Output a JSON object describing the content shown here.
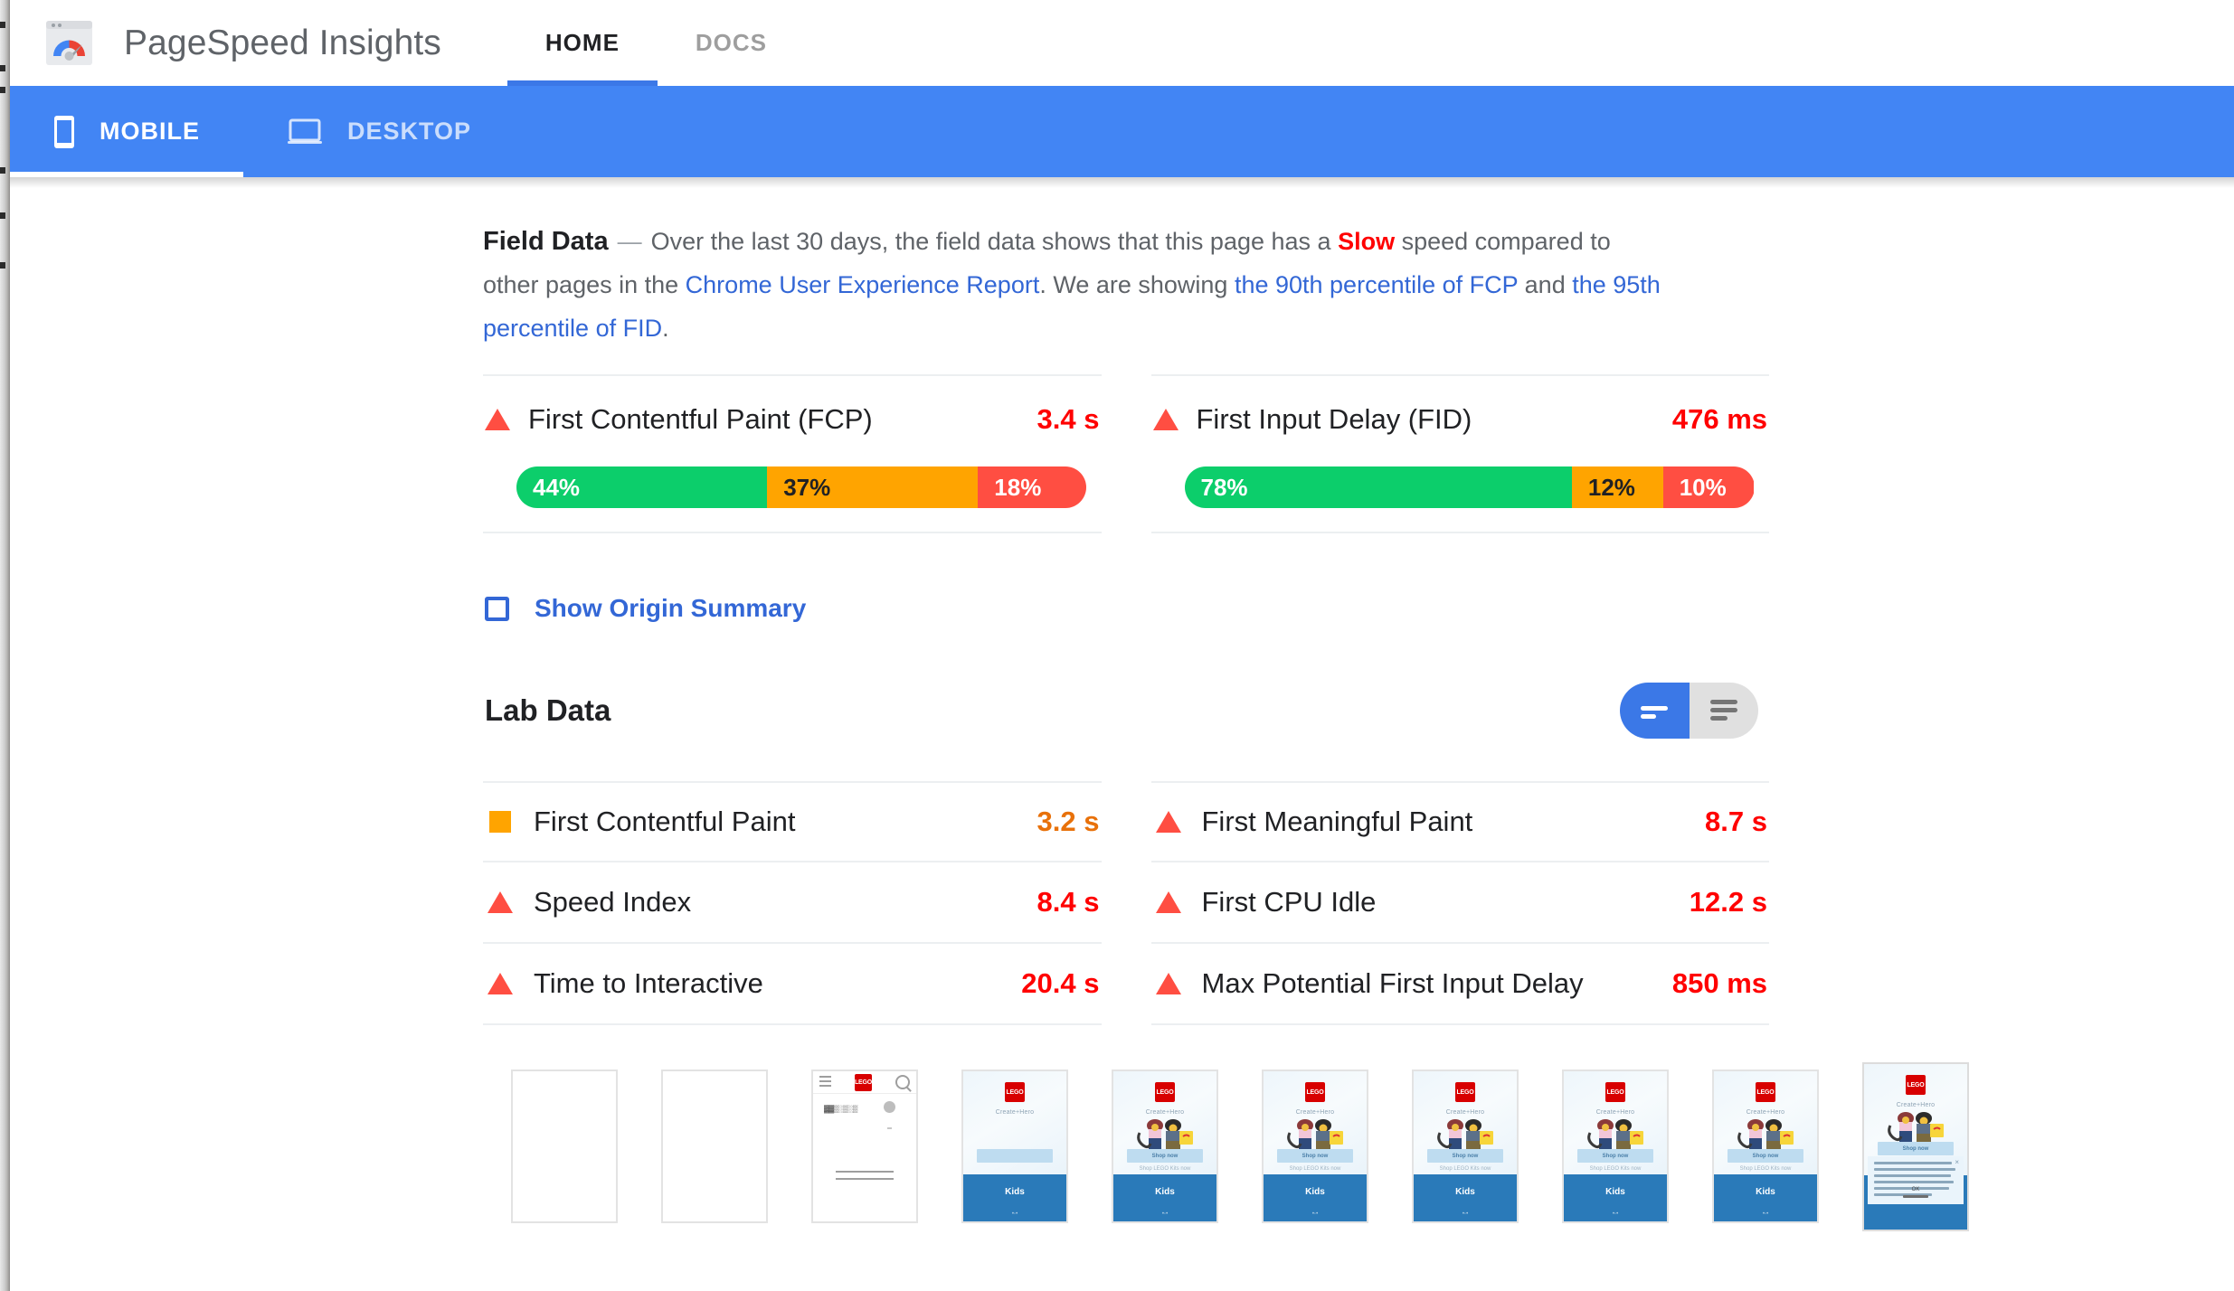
{
  "app": {
    "brand_title": "PageSpeed Insights",
    "logo_icon": "pagespeed-gauge-logo",
    "top_tabs": [
      {
        "label": "HOME",
        "active": true
      },
      {
        "label": "DOCS",
        "active": false
      }
    ],
    "device_tabs": [
      {
        "label": "MOBILE",
        "icon": "mobile-phone-icon",
        "active": true
      },
      {
        "label": "DESKTOP",
        "icon": "laptop-icon",
        "active": false
      }
    ]
  },
  "field_data": {
    "title": "Field Data",
    "dash": "—",
    "text_1": "Over the last 30 days, the field data shows that this page has a ",
    "verdict": "Slow",
    "text_2": " speed compared to other pages in the ",
    "link_crux": "Chrome User Experience Report",
    "text_3": ". We are showing ",
    "link_fcp": "the 90th percentile of FCP",
    "text_4": " and ",
    "link_fid": "the 95th percentile of FID",
    "text_5": ".",
    "metrics": [
      {
        "name": "First Contentful Paint (FCP)",
        "value": "3.4 s",
        "icon": "warning-triangle-icon",
        "status_color": "#ff4e42",
        "distribution": [
          {
            "label": "44%",
            "pct": 44,
            "bucket": "good",
            "color": "#0cce6b"
          },
          {
            "label": "37%",
            "pct": 37,
            "bucket": "average",
            "color": "#ffa400"
          },
          {
            "label": "18%",
            "pct": 19,
            "bucket": "slow",
            "color": "#ff4e42"
          }
        ]
      },
      {
        "name": "First Input Delay (FID)",
        "value": "476 ms",
        "icon": "warning-triangle-icon",
        "status_color": "#ff4e42",
        "distribution": [
          {
            "label": "78%",
            "pct": 68,
            "bucket": "good",
            "color": "#0cce6b"
          },
          {
            "label": "12%",
            "pct": 16,
            "bucket": "average",
            "color": "#ffa400"
          },
          {
            "label": "10%",
            "pct": 16,
            "bucket": "slow",
            "color": "#ff4e42"
          }
        ]
      }
    ],
    "origin_summary": {
      "label": "Show Origin Summary",
      "checked": false,
      "checkbox_icon": "unchecked-checkbox-icon",
      "color": "#3367d6"
    }
  },
  "lab_data": {
    "title": "Lab Data",
    "view_toggle": {
      "left_icon": "compact-view-icon",
      "right_icon": "list-view-icon",
      "active": "left",
      "active_color": "#3b78e7",
      "inactive_color": "#e0e0e0"
    },
    "left_column": [
      {
        "name": "First Contentful Paint",
        "value": "3.2 s",
        "icon": "orange-square-icon",
        "color": "#e8710a"
      },
      {
        "name": "Speed Index",
        "value": "8.4 s",
        "icon": "warning-triangle-icon",
        "color": "#ff0000"
      },
      {
        "name": "Time to Interactive",
        "value": "20.4 s",
        "icon": "warning-triangle-icon",
        "color": "#ff0000"
      }
    ],
    "right_column": [
      {
        "name": "First Meaningful Paint",
        "value": "8.7 s",
        "icon": "warning-triangle-icon",
        "color": "#ff0000"
      },
      {
        "name": "First CPU Idle",
        "value": "12.2 s",
        "icon": "warning-triangle-icon",
        "color": "#ff0000"
      },
      {
        "name": "Max Potential First Input Delay",
        "value": "850 ms",
        "icon": "warning-triangle-icon",
        "color": "#ff0000"
      }
    ]
  },
  "filmstrip": {
    "lego_logo_text": "LEGO",
    "hero_subtitle": "Create+Hero",
    "cta_label": "Shop now",
    "note_label": "Shop LEGO Kits now",
    "kids_label": "Kids",
    "kids_footer": "•◦•",
    "cookie_close": "×",
    "cookie_ok": "OK",
    "frames": [
      {
        "state": "blank"
      },
      {
        "state": "blank"
      },
      {
        "state": "skeleton"
      },
      {
        "state": "partial"
      },
      {
        "state": "loaded"
      },
      {
        "state": "loaded"
      },
      {
        "state": "loaded"
      },
      {
        "state": "loaded"
      },
      {
        "state": "loaded"
      },
      {
        "state": "cookie-banner"
      }
    ]
  }
}
